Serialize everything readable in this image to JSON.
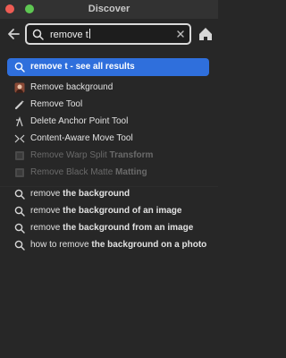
{
  "window": {
    "title": "Discover"
  },
  "search": {
    "value": "remove t"
  },
  "top_result": {
    "query": "remove t",
    "suffix": " - see all results"
  },
  "tools": [
    {
      "label": "Remove background",
      "icon": "remove-background-icon"
    },
    {
      "label": "Remove Tool",
      "icon": "remove-tool-icon"
    },
    {
      "label": "Delete Anchor Point Tool",
      "icon": "delete-anchor-point-icon"
    },
    {
      "label": "Content-Aware Move Tool",
      "icon": "content-aware-move-icon"
    },
    {
      "label_plain": "Remove Warp Split ",
      "label_bold": "Transform",
      "icon": "menu-item-icon",
      "disabled": true
    },
    {
      "label_plain": "Remove Black Matte ",
      "label_bold": "Matting",
      "icon": "menu-item-icon",
      "disabled": true
    }
  ],
  "suggestions": [
    {
      "plain": "remove ",
      "bold": "the background"
    },
    {
      "plain": "remove ",
      "bold": "the background of an image"
    },
    {
      "plain": "remove ",
      "bold": "the background from an image"
    },
    {
      "plain": "how to remove ",
      "bold": "the background on a photo"
    }
  ],
  "colors": {
    "accent": "#2f6fdc",
    "background": "#272727"
  }
}
